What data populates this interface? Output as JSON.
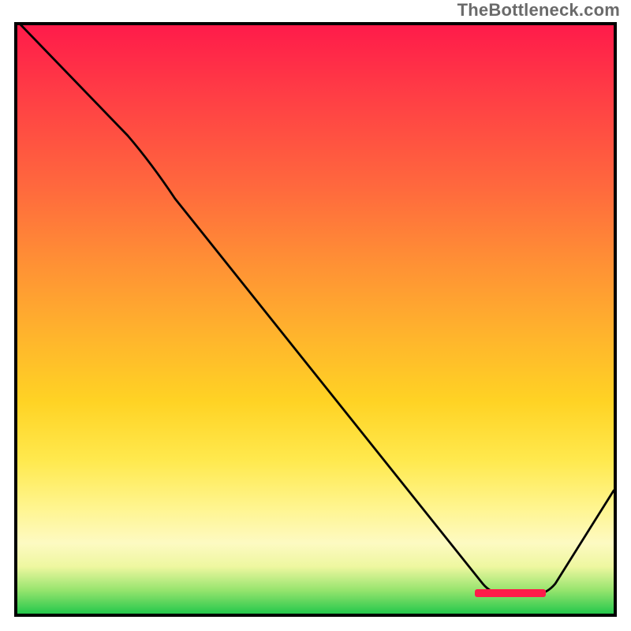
{
  "watermark": "TheBottleneck.com",
  "colors": {
    "gradient_top": "#ff1b4a",
    "gradient_mid": "#ffd324",
    "gradient_bottom": "#25c84c",
    "curve": "#000000",
    "frame": "#000000",
    "marker": "#ff1b4a"
  },
  "chart_data": {
    "type": "line",
    "title": "",
    "xlabel": "",
    "ylabel": "",
    "xlim": [
      0,
      100
    ],
    "ylim": [
      0,
      100
    ],
    "grid": false,
    "legend": false,
    "background": "vertical-gradient red→orange→yellow→green",
    "series": [
      {
        "name": "bottleneck-curve",
        "x": [
          0,
          18,
          26,
          78,
          82,
          87,
          90,
          100
        ],
        "y": [
          100,
          81,
          70,
          3,
          3,
          3,
          5,
          21
        ]
      }
    ],
    "annotations": [
      {
        "name": "trough-marker",
        "shape": "rect",
        "approx_x_range": [
          77,
          88
        ],
        "approx_y": 3,
        "color": "#ff1b4a"
      }
    ]
  }
}
